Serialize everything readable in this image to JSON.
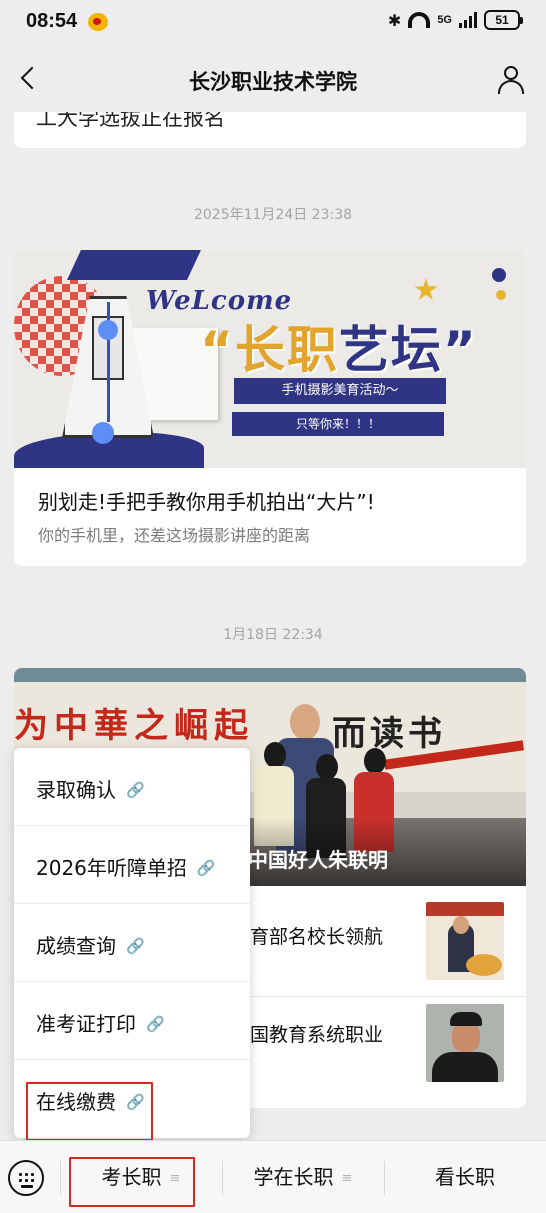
{
  "status_bar": {
    "time": "08:54",
    "network": "5G",
    "battery": "51"
  },
  "header": {
    "title": "长沙职业技术学院"
  },
  "feed": {
    "top_card_cut_text": "工大学选拔正在报名",
    "posts": [
      {
        "timestamp": "2025年11月24日 23:38",
        "banner": {
          "welcome": "WeLcome",
          "headline_part1": "“长职",
          "headline_part2": "艺坛”",
          "subtitle1": "手机摄影美育活动～",
          "subtitle2": "只等你来！！！"
        },
        "title": "别划走!手把手教你用手机拍出“大片”!",
        "description": "你的手机里，还差这场摄影讲座的距离"
      },
      {
        "timestamp": "1月18日 22:34",
        "photo": {
          "slogan_left": "为中華之崛起",
          "slogan_right": "而读书",
          "caption": "中国好人朱联明"
        },
        "sub_items": [
          {
            "title": "育部名校长领航"
          },
          {
            "title": "国教育系统职业"
          }
        ]
      }
    ]
  },
  "popup_menu": {
    "items": [
      {
        "label": "录取确认",
        "icon": "link-icon"
      },
      {
        "label": "2026年听障单招",
        "icon": "link-icon"
      },
      {
        "label": "成绩查询",
        "icon": "link-icon"
      },
      {
        "label": "准考证打印",
        "icon": "link-icon"
      },
      {
        "label": "在线缴费",
        "icon": "link-icon"
      }
    ]
  },
  "bottom_bar": {
    "tabs": [
      {
        "label": "考长职",
        "has_menu": true
      },
      {
        "label": "学在长职",
        "has_menu": true
      },
      {
        "label": "看长职",
        "has_menu": false
      }
    ]
  },
  "colors": {
    "background": "#ededed",
    "highlight": "#d12a1f",
    "timestamp": "#a4a4a4",
    "brand_blue": "#2f3584"
  }
}
